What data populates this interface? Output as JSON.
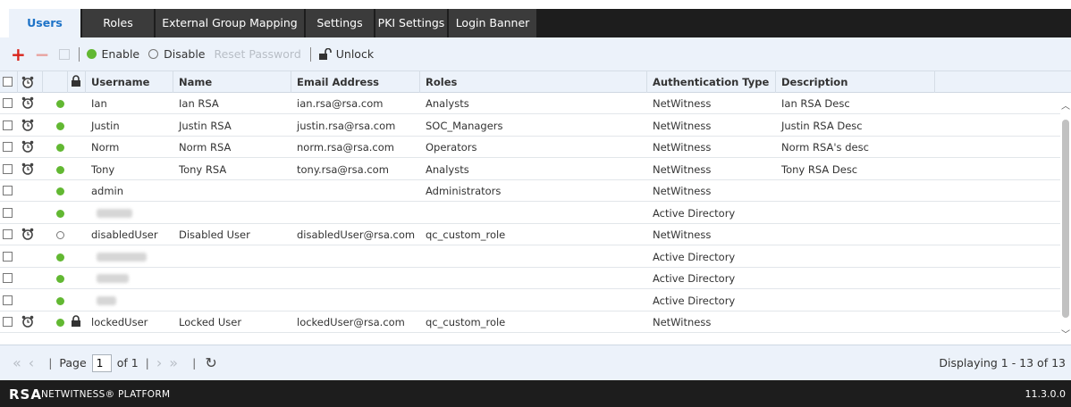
{
  "tabs": [
    {
      "label": "Users",
      "active": true
    },
    {
      "label": "Roles"
    },
    {
      "label": "External Group Mapping"
    },
    {
      "label": "Settings"
    },
    {
      "label": "PKI Settings"
    },
    {
      "label": "Login Banner"
    }
  ],
  "toolbar": {
    "add": "+",
    "remove": "−",
    "enable": "Enable",
    "disable": "Disable",
    "reset_password": "Reset Password",
    "unlock": "Unlock"
  },
  "columns": {
    "username": "Username",
    "name": "Name",
    "email": "Email Address",
    "roles": "Roles",
    "auth_type": "Authentication Type",
    "description": "Description"
  },
  "rows": [
    {
      "alarm": true,
      "status": "enabled",
      "locked": false,
      "username": "Ian",
      "name": "Ian RSA",
      "email": "ian.rsa@rsa.com",
      "roles": "Analysts",
      "auth": "NetWitness",
      "desc": "Ian RSA Desc"
    },
    {
      "alarm": true,
      "status": "enabled",
      "locked": false,
      "username": "Justin",
      "name": "Justin RSA",
      "email": "justin.rsa@rsa.com",
      "roles": "SOC_Managers",
      "auth": "NetWitness",
      "desc": "Justin RSA Desc"
    },
    {
      "alarm": true,
      "status": "enabled",
      "locked": false,
      "username": "Norm",
      "name": "Norm RSA",
      "email": "norm.rsa@rsa.com",
      "roles": "Operators",
      "auth": "NetWitness",
      "desc": "Norm RSA's desc"
    },
    {
      "alarm": true,
      "status": "enabled",
      "locked": false,
      "username": "Tony",
      "name": "Tony RSA",
      "email": "tony.rsa@rsa.com",
      "roles": "Analysts",
      "auth": "NetWitness",
      "desc": "Tony RSA Desc"
    },
    {
      "alarm": false,
      "status": "enabled",
      "locked": false,
      "username": "admin",
      "name": "",
      "email": "",
      "roles": "Administrators",
      "auth": "NetWitness",
      "desc": ""
    },
    {
      "alarm": false,
      "status": "enabled",
      "locked": false,
      "username": "",
      "blurred": true,
      "name": "",
      "email": "",
      "roles": "",
      "auth": "Active Directory",
      "desc": ""
    },
    {
      "alarm": true,
      "status": "disabled",
      "locked": false,
      "username": "disabledUser",
      "name": "Disabled User",
      "email": "disabledUser@rsa.com",
      "roles": "qc_custom_role",
      "auth": "NetWitness",
      "desc": ""
    },
    {
      "alarm": false,
      "status": "enabled",
      "locked": false,
      "username": "",
      "blurred": true,
      "name": "",
      "email": "",
      "roles": "",
      "auth": "Active Directory",
      "desc": ""
    },
    {
      "alarm": false,
      "status": "enabled",
      "locked": false,
      "username": "",
      "blurred": true,
      "name": "",
      "email": "",
      "roles": "",
      "auth": "Active Directory",
      "desc": ""
    },
    {
      "alarm": false,
      "status": "enabled",
      "locked": false,
      "username": "",
      "blurred": true,
      "name": "",
      "email": "",
      "roles": "",
      "auth": "Active Directory",
      "desc": ""
    },
    {
      "alarm": true,
      "status": "enabled",
      "locked": true,
      "username": "lockedUser",
      "name": "Locked User",
      "email": "lockedUser@rsa.com",
      "roles": "qc_custom_role",
      "auth": "NetWitness",
      "desc": ""
    }
  ],
  "pager": {
    "page_label": "Page",
    "page_value": "1",
    "of_label": "of 1",
    "display": "Displaying 1 - 13 of 13"
  },
  "footer": {
    "logo": "RSA",
    "product": "NETWITNESS® PLATFORM",
    "version": "11.3.0.0"
  },
  "colors": {
    "accent": "#1e73c7",
    "enabled": "#62b832",
    "add": "#d9251c",
    "dark": "#1d1d1d"
  }
}
